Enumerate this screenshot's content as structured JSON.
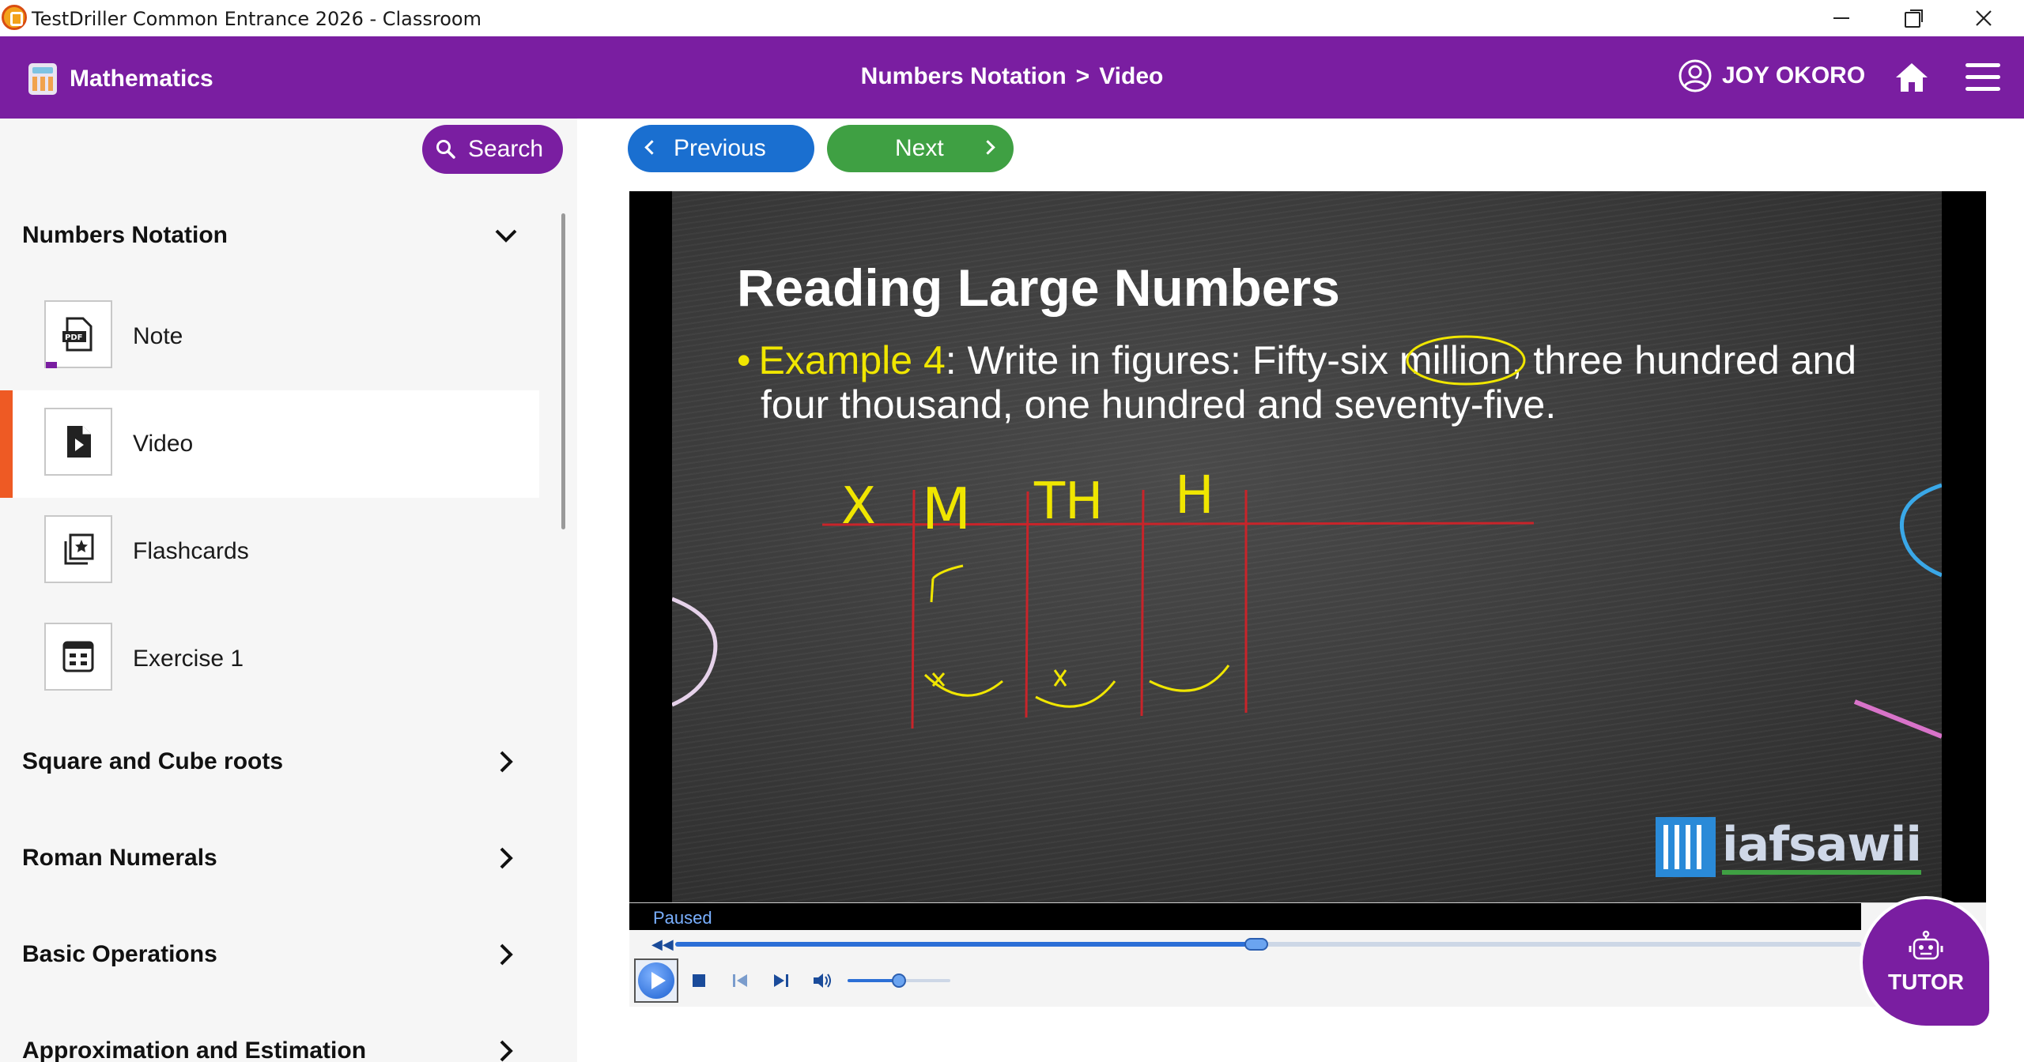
{
  "window": {
    "title": "TestDriller Common Entrance 2026 - Classroom",
    "icons": [
      "app-icon",
      "minimize-icon",
      "maximize-icon",
      "close-icon"
    ]
  },
  "header": {
    "subject": "Mathematics",
    "breadcrumb": {
      "topic": "Numbers Notation",
      "separator": ">",
      "page": "Video"
    },
    "user": "JOY OKORO",
    "icons": [
      "calculator-icon",
      "user-circle-icon",
      "home-icon",
      "hamburger-menu-icon"
    ],
    "color": "#7a1ea1"
  },
  "sidebar": {
    "search_label": "Search",
    "topics": [
      {
        "title": "Numbers Notation",
        "expanded": true,
        "lessons": [
          {
            "label": "Note",
            "icon": "pdf-icon",
            "active": false
          },
          {
            "label": "Video",
            "icon": "video-file-icon",
            "active": true
          },
          {
            "label": "Flashcards",
            "icon": "flashcards-icon",
            "active": false
          },
          {
            "label": "Exercise 1",
            "icon": "exercise-icon",
            "active": false
          }
        ]
      },
      {
        "title": "Square and Cube roots",
        "expanded": false
      },
      {
        "title": "Roman Numerals",
        "expanded": false
      },
      {
        "title": "Basic Operations",
        "expanded": false
      },
      {
        "title": "Approximation and Estimation",
        "expanded": false
      }
    ],
    "active_color": "#ee5a24"
  },
  "nav": {
    "previous_label": "Previous",
    "next_label": "Next",
    "previous_color": "#1a6fd0",
    "next_color": "#3fa043"
  },
  "video": {
    "slide_title": "Reading Large Numbers",
    "slide_example_label": "Example 4",
    "slide_text_1": ": Write in figures: Fifty-six million, three hundred and",
    "slide_text_2": "four thousand, one hundred and seventy-five.",
    "board_columns": [
      "X",
      "M",
      "TH",
      "H"
    ],
    "logo_text": "iafsawii",
    "status": "Paused",
    "seek_progress": 0.49,
    "volume_level": 0.5
  },
  "tutor": {
    "label": "TUTOR",
    "icon": "robot-icon"
  }
}
